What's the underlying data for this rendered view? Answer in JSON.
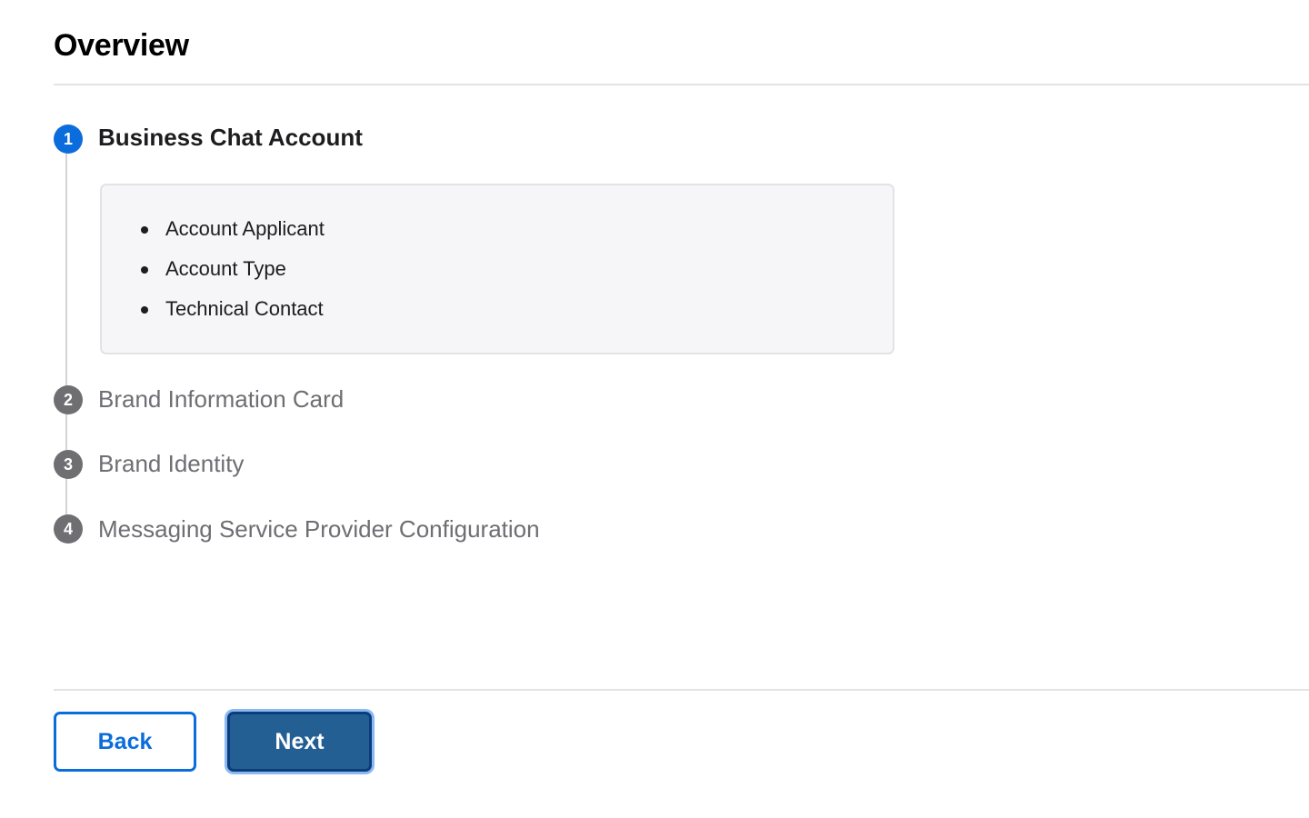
{
  "page": {
    "title": "Overview"
  },
  "steps": [
    {
      "number": "1",
      "title": "Business Chat Account",
      "state": "active",
      "details": [
        "Account Applicant",
        "Account Type",
        "Technical Contact"
      ]
    },
    {
      "number": "2",
      "title": "Brand Information Card",
      "state": "inactive"
    },
    {
      "number": "3",
      "title": "Brand Identity",
      "state": "inactive"
    },
    {
      "number": "4",
      "title": "Messaging Service Provider Configuration",
      "state": "inactive"
    }
  ],
  "footer": {
    "back_label": "Back",
    "next_label": "Next"
  },
  "colors": {
    "accent": "#0b6ddb",
    "primary_button": "#245f93",
    "inactive_step": "#6e6e73"
  },
  "icons": {
    "bullet": "bullet-dot-icon"
  }
}
